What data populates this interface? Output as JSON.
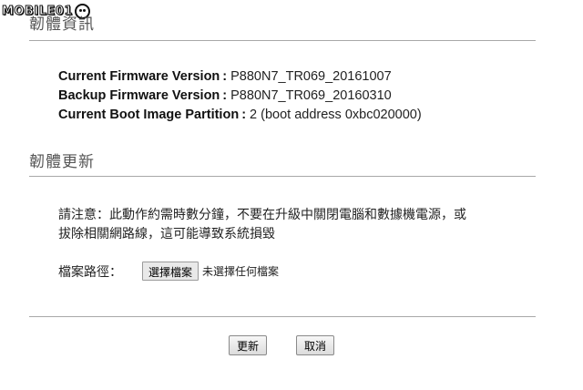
{
  "watermark": {
    "text": "MOBILE01",
    "face_icon": "smiley-face-icon"
  },
  "firmware_info": {
    "heading": "韌體資訊",
    "rows": [
      {
        "label": "Current Firmware Version",
        "sep": ":",
        "value": "P880N7_TR069_20161007"
      },
      {
        "label": "Backup Firmware Version",
        "sep": ":",
        "value": "P880N7_TR069_20160310"
      },
      {
        "label": "Current Boot Image Partition",
        "sep": ":",
        "value": "2 (boot address 0xbc020000)"
      }
    ]
  },
  "firmware_update": {
    "heading": "韌體更新",
    "notice_line1": "請注意：此動作約需時數分鐘，不要在升級中關閉電腦和數據機電源，或",
    "notice_line2": "拔除相關網路線，這可能導致系統損毀",
    "file_path_label": "檔案路徑：",
    "choose_file_button": "選擇檔案",
    "no_file_selected": "未選擇任何檔案"
  },
  "actions": {
    "update_button": "更新",
    "cancel_button": "取消"
  }
}
